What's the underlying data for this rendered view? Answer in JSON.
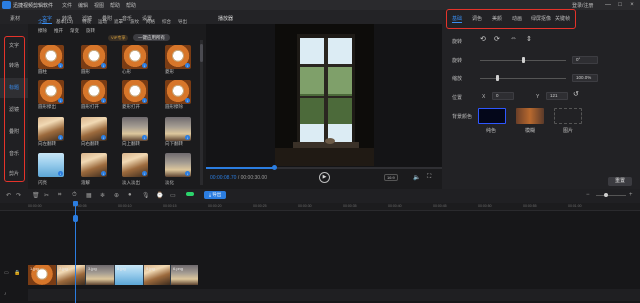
{
  "app": {
    "title": "迅捷视频剪辑软件",
    "menu": [
      "文件",
      "编辑",
      "视图",
      "帮助",
      "帮助"
    ],
    "login": "登录/注册",
    "window_controls": [
      "—",
      "□",
      "×"
    ]
  },
  "main_tabs": {
    "items": [
      "素材",
      "文字",
      "转场",
      "滤镜",
      "叠附",
      "音乐",
      "设置"
    ],
    "active": "文字"
  },
  "sidebar": {
    "items": [
      "文字",
      "转场",
      "标题",
      "滤镜",
      "叠附",
      "音乐",
      "剪片"
    ],
    "active": "标题"
  },
  "library": {
    "subcats_row1": [
      "全部",
      "基本(13)",
      "特效",
      "运动",
      "遮罩",
      "波纹",
      "网格",
      "综合",
      "导出"
    ],
    "subcats_row2": [
      "擦除",
      "推开",
      "渐变",
      "旋转",
      "VIP专享"
    ],
    "active_subcat": "全部",
    "vip_label": "VIP专享",
    "apply_all_label": "一键应用所有",
    "items": [
      {
        "label": "圆柱",
        "style": "window"
      },
      {
        "label": "圆形",
        "style": "window"
      },
      {
        "label": "心形",
        "style": "window"
      },
      {
        "label": "菱形",
        "style": "window"
      },
      {
        "label": "圆形擦出",
        "style": "window"
      },
      {
        "label": "圆形打开",
        "style": "window"
      },
      {
        "label": "菱形打开",
        "style": "window"
      },
      {
        "label": "圆形擦除",
        "style": "window"
      },
      {
        "label": "向左翻转",
        "style": "street"
      },
      {
        "label": "向右翻转",
        "style": "street"
      },
      {
        "label": "向上翻转",
        "style": "rain"
      },
      {
        "label": "向下翻转",
        "style": "rain"
      },
      {
        "label": "闪亮",
        "style": "blue"
      },
      {
        "label": "溶解",
        "style": "street"
      },
      {
        "label": "淡入淡出",
        "style": "street"
      },
      {
        "label": "淡化",
        "style": "rain"
      }
    ]
  },
  "preview": {
    "label": "播放器",
    "time_current": "00:00:08.70",
    "time_total": "/ 00:00:30.00",
    "ratio": "16:9",
    "play_icon": "▶",
    "volume_icon": "🔈",
    "fullscreen_icon": "⛶"
  },
  "right_panel": {
    "tabs": [
      "基础",
      "调色",
      "美颜",
      "动画",
      "绿屏抠像",
      "关键帧"
    ],
    "active_tab": "基础",
    "rotate_label": "旋转",
    "rotate_icons": [
      "⟲",
      "⟳",
      "⇔",
      "⇕"
    ],
    "rotation_label": "旋转",
    "rotation_value": "0°",
    "rotation_fraction": 0.5,
    "scale_label": "缩放",
    "scale_value": "100.0%",
    "scale_fraction": 0.2,
    "position_label": "位置",
    "x_label": "X",
    "x_value": "0",
    "y_label": "Y",
    "y_value": "121",
    "bg_label": "背景颜色",
    "bg_options": [
      "纯色",
      "模糊",
      "图片"
    ],
    "reset_label": "重置",
    "highlight_color": "#e5332a",
    "accent_color": "#2b7de0"
  },
  "timeline": {
    "export_label": "导出",
    "ruler_ticks": [
      "00:00:00",
      "00:00:05",
      "00:00:10",
      "00:00:15",
      "00:00:20",
      "00:00:25",
      "00:00:30",
      "00:00:35",
      "00:00:40",
      "00:00:45",
      "00:00:50",
      "00:00:55",
      "00:01:00"
    ],
    "clips": [
      {
        "name": "1.jpg",
        "style": "window"
      },
      {
        "name": "2.jpg",
        "style": "street"
      },
      {
        "name": "3.jpg",
        "style": "rain"
      },
      {
        "name": "8.jpg",
        "style": "blue"
      },
      {
        "name": "5.jpg",
        "style": "street"
      },
      {
        "name": "6.png",
        "style": "rain"
      }
    ]
  }
}
